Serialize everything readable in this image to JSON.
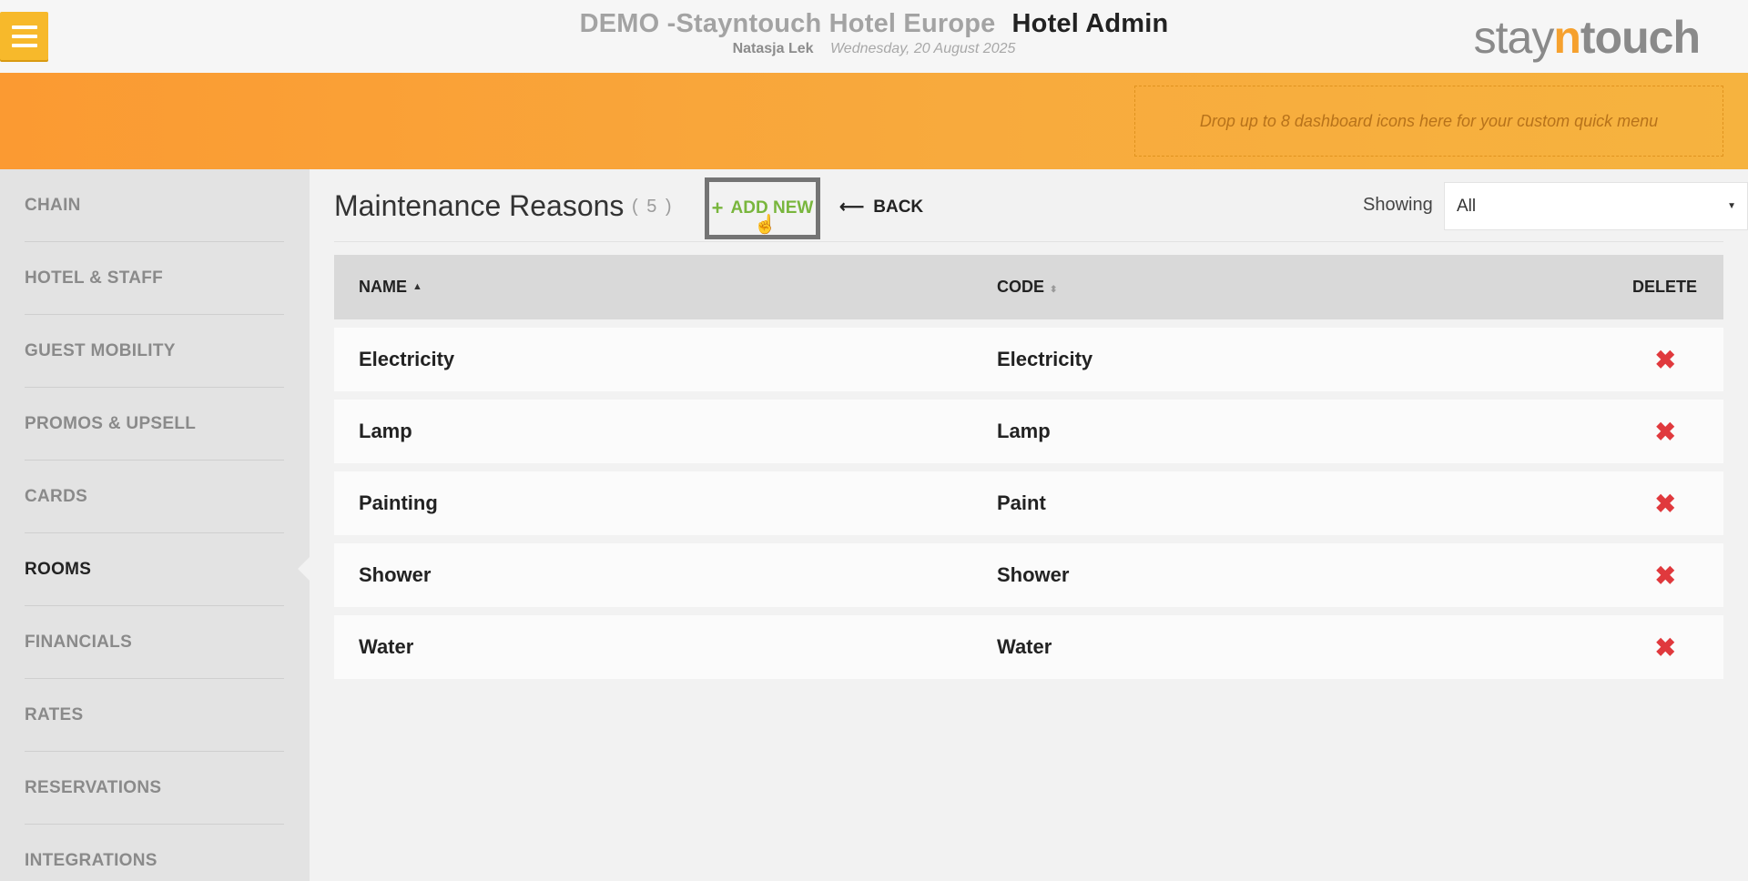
{
  "header": {
    "hotel_name": "DEMO -Stayntouch Hotel Europe",
    "app_name": "Hotel Admin",
    "user": "Natasja Lek",
    "date": "Wednesday, 20 August 2025",
    "logo": {
      "pre": "stay",
      "n": "n",
      "post": "touch"
    }
  },
  "quick_menu": {
    "placeholder": "Drop up to 8 dashboard icons here for your custom quick menu"
  },
  "sidebar": {
    "items": [
      {
        "label": "CHAIN"
      },
      {
        "label": "HOTEL & STAFF"
      },
      {
        "label": "GUEST MOBILITY"
      },
      {
        "label": "PROMOS & UPSELL"
      },
      {
        "label": "CARDS"
      },
      {
        "label": "ROOMS",
        "active": true
      },
      {
        "label": "FINANCIALS"
      },
      {
        "label": "RATES"
      },
      {
        "label": "RESERVATIONS"
      },
      {
        "label": "INTEGRATIONS"
      }
    ]
  },
  "page": {
    "title": "Maintenance Reasons",
    "count": "( 5 )",
    "add_label": "ADD NEW",
    "back_label": "BACK",
    "showing_label": "Showing",
    "showing_value": "All"
  },
  "table": {
    "headers": {
      "name": "NAME",
      "code": "CODE",
      "delete": "DELETE"
    },
    "rows": [
      {
        "name": "Electricity",
        "code": "Electricity"
      },
      {
        "name": "Lamp",
        "code": "Lamp"
      },
      {
        "name": "Painting",
        "code": "Paint"
      },
      {
        "name": "Shower",
        "code": "Shower"
      },
      {
        "name": "Water",
        "code": "Water"
      }
    ]
  },
  "colors": {
    "accent": "#f7b92b",
    "band": "#fb9a32",
    "add": "#79b63d",
    "delete": "#e0393d"
  },
  "icons": {
    "menu": "hamburger-icon",
    "add": "plus-icon",
    "back": "arrow-left-icon",
    "delete": "x-icon",
    "cursor": "hand-pointer-icon"
  }
}
